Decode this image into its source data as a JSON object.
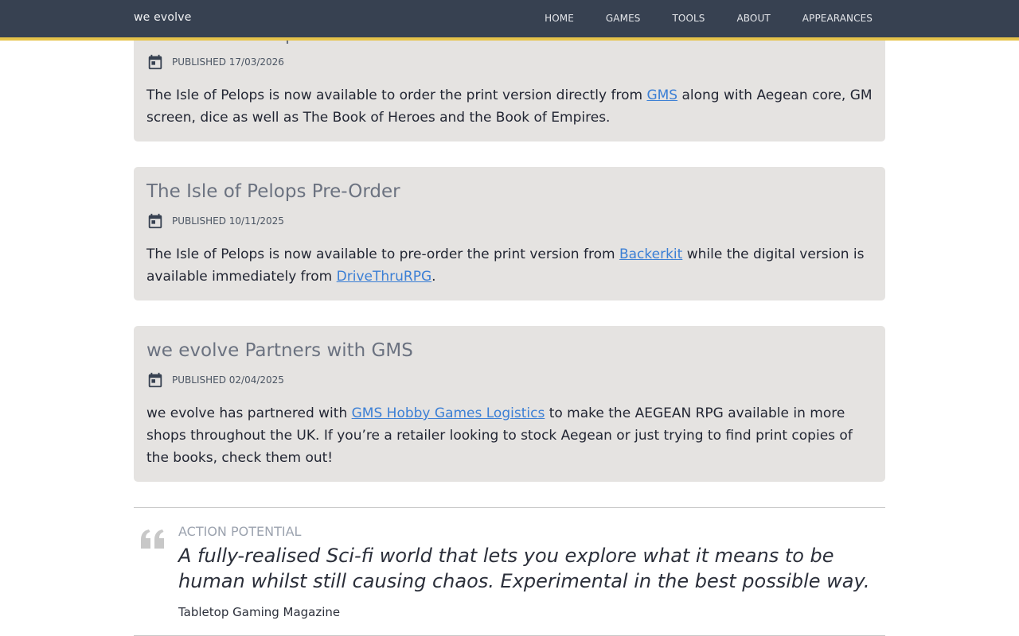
{
  "brand": "we evolve",
  "nav": [
    "HOME",
    "GAMES",
    "TOOLS",
    "ABOUT",
    "APPEARANCES"
  ],
  "posts": [
    {
      "title": "The Isle of Pelops",
      "published": "PUBLISHED 17/03/2026",
      "body": [
        {
          "text": "The Isle of Pelops is now available to order the print version directly from "
        },
        {
          "link": "GMS"
        },
        {
          "text": " along with Aegean core, GM screen, dice as well as The Book of Heroes and the Book of Empires."
        }
      ]
    },
    {
      "title": "The Isle of Pelops Pre-Order",
      "published": "PUBLISHED 10/11/2025",
      "body": [
        {
          "text": "The Isle of Pelops is now available to pre-order the print version from "
        },
        {
          "link": "Backerkit"
        },
        {
          "text": " while the digital version is available immediately from "
        },
        {
          "link": "DriveThruRPG"
        },
        {
          "text": "."
        }
      ]
    },
    {
      "title": "we evolve Partners with GMS",
      "published": "PUBLISHED 02/04/2025",
      "body": [
        {
          "text": "we evolve has partnered with "
        },
        {
          "link": "GMS Hobby Games Logistics"
        },
        {
          "text": " to make the AEGEAN RPG available in more shops throughout the UK. If you’re a retailer looking to stock Aegean or just trying to find print copies of the books, check them out!"
        }
      ]
    }
  ],
  "quote": {
    "source": "ACTION POTENTIAL",
    "text": "A fully-realised Sci-fi world that lets you explore what it means to be human whilst still causing chaos. Experimental in the best possible way.",
    "publication": "Tabletop Gaming Magazine"
  },
  "colors": {
    "topbar": "#374151",
    "accent": "#e6c34a",
    "card": "#e5e3e1",
    "link": "#3b7fd5"
  }
}
